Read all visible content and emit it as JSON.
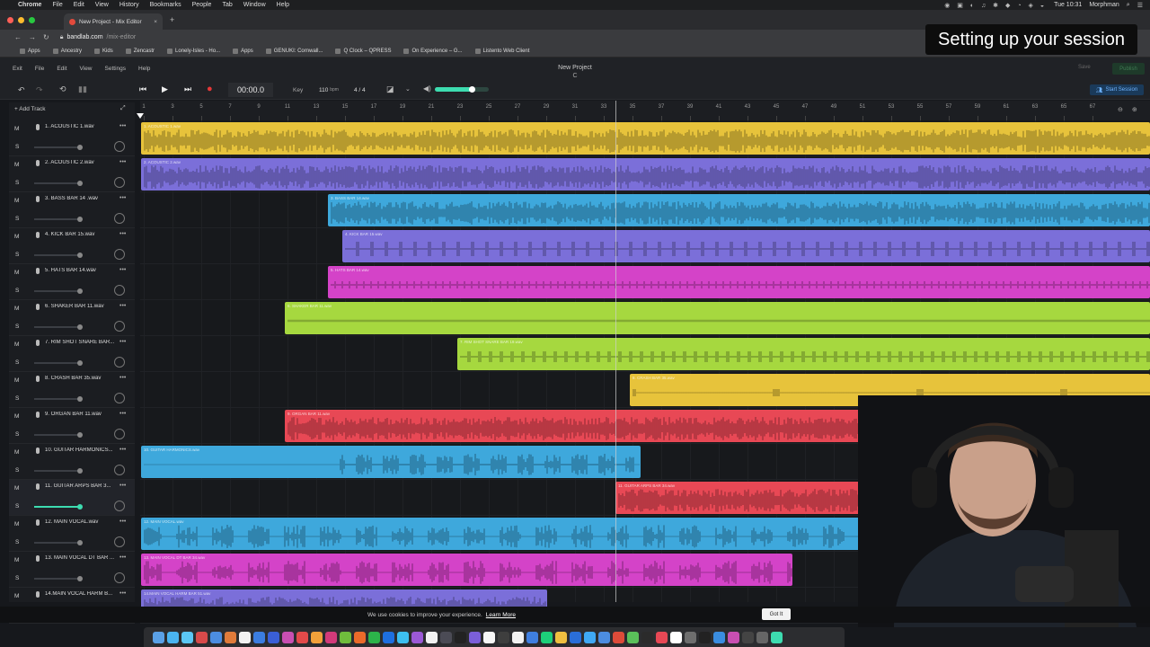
{
  "macos": {
    "apple": "",
    "menus": [
      "Chrome",
      "File",
      "Edit",
      "View",
      "History",
      "Bookmarks",
      "People",
      "Tab",
      "Window",
      "Help"
    ],
    "clock": "Tue 10:31",
    "user": "Morphman"
  },
  "browser": {
    "tab_title": "New Project - Mix Editor",
    "tab_close": "×",
    "new_tab": "+",
    "url_host": "bandlab.com",
    "url_path": "/mix-editor",
    "bookmarks": [
      "Apps",
      "Ancestry",
      "Kids",
      "Zencastr",
      "Lonely-Isles - Ho...",
      "Apps",
      "GENUKI: Cornwall...",
      "Q Clock – QPRESS",
      "On Experience – G...",
      "Listento Web Client"
    ]
  },
  "overlay": {
    "title": "Setting up your session"
  },
  "app": {
    "menu": [
      "Exit",
      "File",
      "Edit",
      "View",
      "Settings",
      "Help"
    ],
    "project_name": "New Project",
    "project_key": "C",
    "save_label": "Save",
    "publish_label": "Publish",
    "timecode": "00:00.0",
    "key_label": "Key",
    "bpm": "110",
    "bpm_unit": "bpm",
    "time_sig": "4 / 4",
    "volume_level": 0.7,
    "start_session_label": "Start Session",
    "add_track_label": "Add Track",
    "mute_label": "M",
    "solo_label": "S",
    "track_menu": "•••"
  },
  "ruler": {
    "ticks": [
      "1",
      "3",
      "5",
      "7",
      "9",
      "11",
      "13",
      "15",
      "17",
      "19",
      "21",
      "23",
      "25",
      "27",
      "29",
      "31",
      "33",
      "35",
      "37",
      "39",
      "41",
      "43",
      "45",
      "47",
      "49",
      "51",
      "53",
      "55",
      "57",
      "59",
      "61",
      "63",
      "65",
      "67"
    ]
  },
  "tracks": [
    {
      "name": "1. ACOUSTIC 1.wav",
      "clip_label": "1. ACOUSTIC 1.wav",
      "color": "#e7c33b"
    },
    {
      "name": "2. ACOUSTIC 2.wav",
      "clip_label": "2. ACOUSTIC 2.wav",
      "color": "#7b6fd9"
    },
    {
      "name": "3. BASS BAR 14 .wav",
      "clip_label": "3. BASS BAR 14.wav",
      "color": "#3ea8dc"
    },
    {
      "name": "4. KICK BAR 15.wav",
      "clip_label": "4. KICK BAR 15.wav",
      "color": "#7b6fd9"
    },
    {
      "name": "5. HATS BAR 14.wav",
      "clip_label": "5. HATS BAR 14.wav",
      "color": "#d443c8"
    },
    {
      "name": "6. SHAKER BAR 11.wav",
      "clip_label": "6. SHAKER BAR 11.wav",
      "color": "#a6d83f"
    },
    {
      "name": "7. RIM SHOT SNARE BAR...",
      "clip_label": "7. RIM SHOT SNARE BAR 19.wav",
      "color": "#a6d83f"
    },
    {
      "name": "8. CRASH BAR 35.wav",
      "clip_label": "8. CRASH BAR 35.wav",
      "color": "#e7c33b"
    },
    {
      "name": "9. ORGAN BAR 11.wav",
      "clip_label": "9. ORGAN BAR 11.wav",
      "color": "#e84855"
    },
    {
      "name": "10. GUITAR HARMONICS...",
      "clip_label": "10. GUITAR HARMONICS.wav",
      "color": "#3ea8dc"
    },
    {
      "name": "11. GUITAR ARPS BAR 3...",
      "clip_label": "11. GUITAR ARPS BAR 34.wav",
      "color": "#e84855"
    },
    {
      "name": "12. MAIN VOCAL.wav",
      "clip_label": "12. MAIN VOCAL.wav",
      "color": "#3ea8dc"
    },
    {
      "name": "13. MAIN VOCAL DT BAR ...",
      "clip_label": "13. MAIN VOCAL DT BAR 34.wav",
      "color": "#d443c8"
    },
    {
      "name": "14.MAIN VOCAL HARM B...",
      "clip_label": "14.MAIN VOCAL HARM BAR 51.wav",
      "color": "#7b6fd9"
    }
  ],
  "cookie": {
    "text": "We use cookies to improve your experience.",
    "link": "Learn More",
    "button": "Got It"
  }
}
